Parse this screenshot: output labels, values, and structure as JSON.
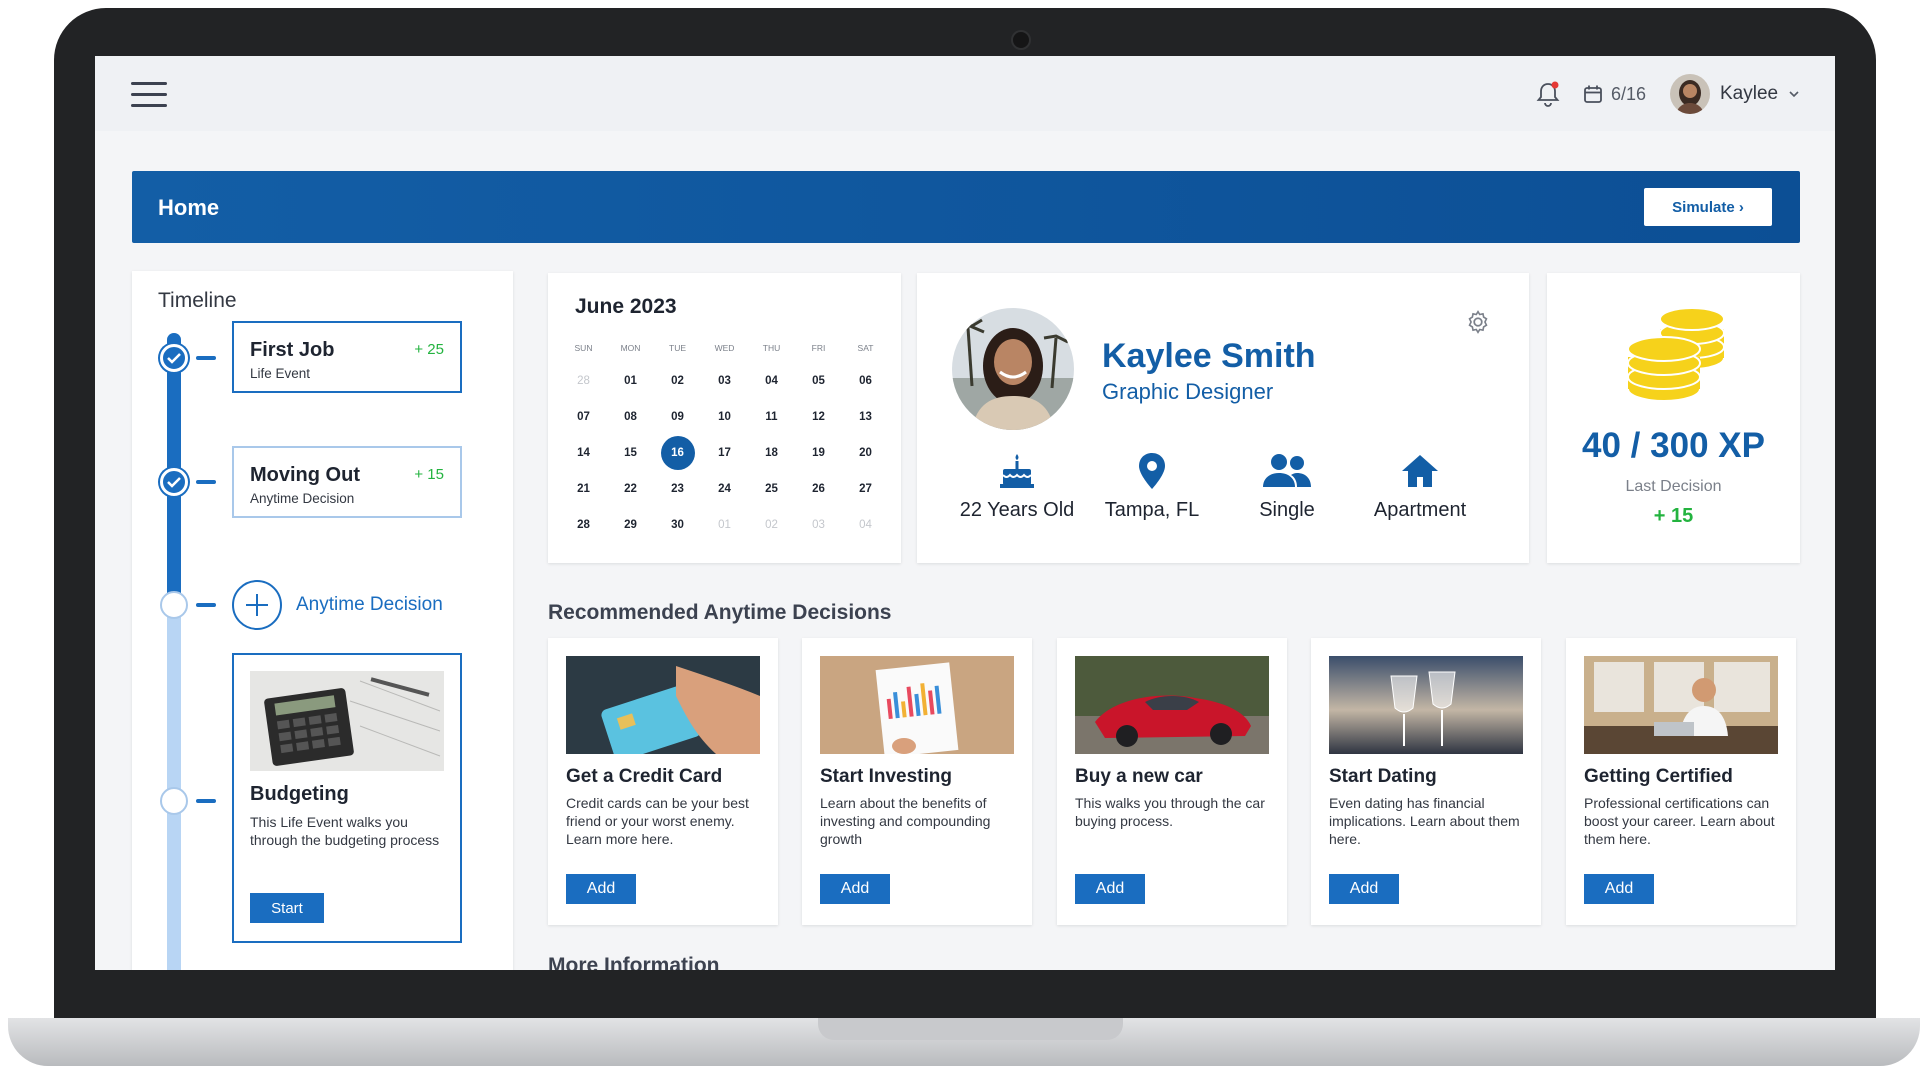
{
  "topbar": {
    "date": "6/16",
    "user_name": "Kaylee"
  },
  "header": {
    "title": "Home",
    "simulate_label": "Simulate ›"
  },
  "timeline": {
    "title": "Timeline",
    "events": [
      {
        "title": "First Job",
        "subtitle": "Life Event",
        "xp": "+ 25"
      },
      {
        "title": "Moving Out",
        "subtitle": "Anytime Decision",
        "xp": "+ 15"
      }
    ],
    "add_label": "Anytime Decision",
    "upcoming": {
      "title": "Budgeting",
      "description": "This Life Event walks you through the budgeting process",
      "button": "Start"
    }
  },
  "calendar": {
    "title": "June 2023",
    "weekdays": [
      "SUN",
      "MON",
      "TUE",
      "WED",
      "THU",
      "FRI",
      "SAT"
    ],
    "days": [
      "28",
      "01",
      "02",
      "03",
      "04",
      "05",
      "06",
      "07",
      "08",
      "09",
      "10",
      "11",
      "12",
      "13",
      "14",
      "15",
      "16",
      "17",
      "18",
      "19",
      "20",
      "21",
      "22",
      "23",
      "24",
      "25",
      "26",
      "27",
      "28",
      "29",
      "30",
      "01",
      "02",
      "03",
      "04"
    ],
    "selected_day": "16"
  },
  "profile": {
    "name": "Kaylee Smith",
    "role": "Graphic Designer",
    "stats": [
      {
        "icon": "birthday-cake-icon",
        "label": "22 Years Old"
      },
      {
        "icon": "location-pin-icon",
        "label": "Tampa, FL"
      },
      {
        "icon": "people-icon",
        "label": "Single"
      },
      {
        "icon": "house-icon",
        "label": "Apartment"
      }
    ]
  },
  "xp": {
    "value": "40 / 300 XP",
    "label": "Last Decision",
    "gain": "+ 15"
  },
  "recommended": {
    "title": "Recommended Anytime Decisions",
    "add_label": "Add",
    "cards": [
      {
        "title": "Get a Credit Card",
        "description": "Credit cards can be your best friend or your worst enemy. Learn more here."
      },
      {
        "title": "Start Investing",
        "description": "Learn about the benefits of investing and compounding growth"
      },
      {
        "title": "Buy a new car",
        "description": "This walks you through the car buying process."
      },
      {
        "title": "Start Dating",
        "description": "Even dating has financial implications. Learn about them here."
      },
      {
        "title": "Getting Certified",
        "description": "Professional certifications can boost your career. Learn about them here."
      }
    ]
  },
  "more_info": "More Information",
  "colors": {
    "primary": "#135ea6",
    "accent": "#1a6dc0",
    "success": "#23b33f"
  }
}
